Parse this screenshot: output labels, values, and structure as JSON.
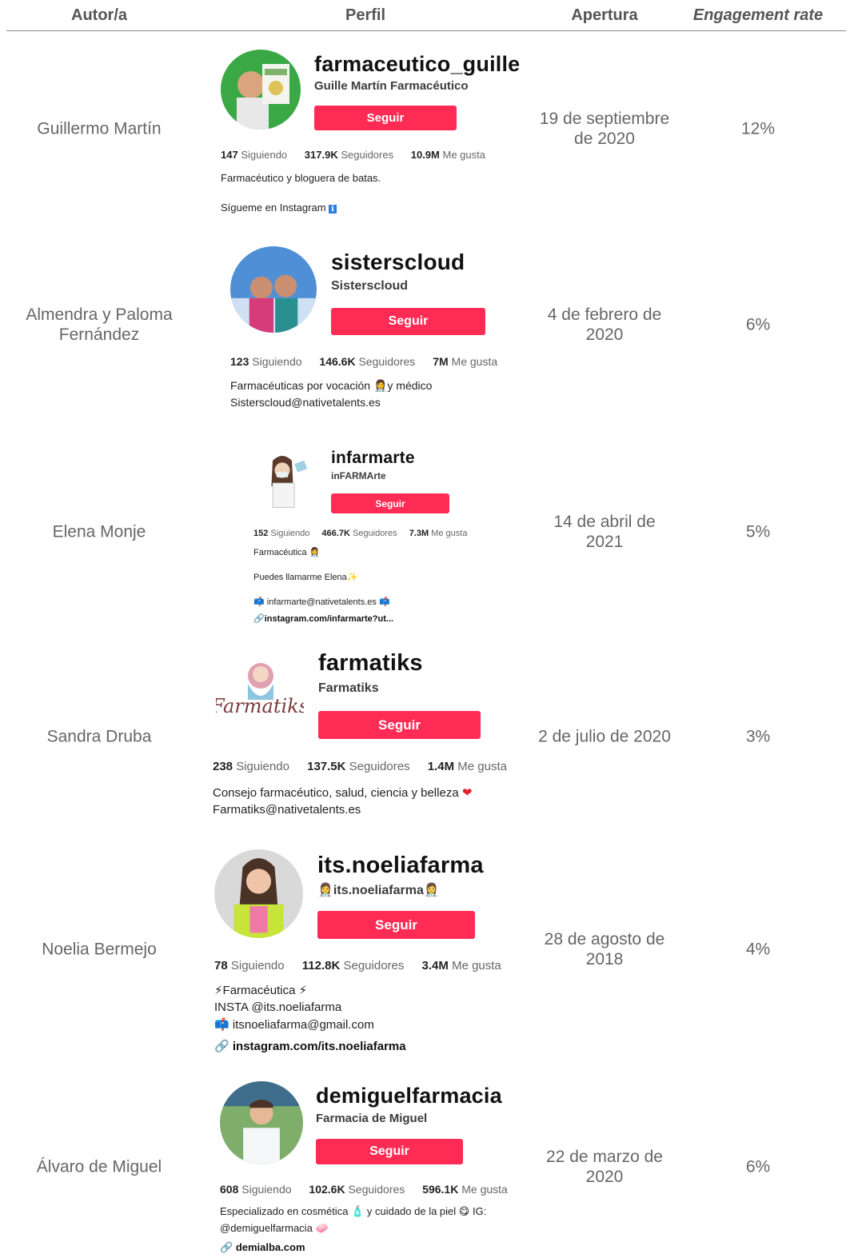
{
  "headers": {
    "author": "Autor/a",
    "profile": "Perfil",
    "opening": "Apertura",
    "engagement": "Engagement rate"
  },
  "rows": [
    {
      "author": "Guillermo Martín",
      "username": "farmaceutico_guille",
      "display_name": "Guille Martín Farmacéutico",
      "follow": "Seguir",
      "following": "147",
      "following_label": "Siguiendo",
      "followers": "317.9K",
      "followers_label": "Seguidores",
      "likes": "10.9M",
      "likes_label": "Me gusta",
      "bio": [
        "Farmacéutico y bloguera de batas.",
        "Sígueme en Instagram"
      ],
      "opening": "19 de septiembre de 2020",
      "engagement": "12%"
    },
    {
      "author": "Almendra y Paloma Fernández",
      "username": "sisterscloud",
      "display_name": "Sisterscloud",
      "follow": "Seguir",
      "following": "123",
      "following_label": "Siguiendo",
      "followers": "146.6K",
      "followers_label": "Seguidores",
      "likes": "7M",
      "likes_label": "Me gusta",
      "bio": [
        "Farmacéuticas por vocación",
        "y médico",
        "Sisterscloud@nativetalents.es"
      ],
      "opening": "4 de febrero de 2020",
      "engagement": "6%"
    },
    {
      "author": "Elena Monje",
      "username": "infarmarte",
      "display_name": "inFARMArte",
      "follow": "Seguir",
      "following": "152",
      "following_label": "Siguiendo",
      "followers": "466.7K",
      "followers_label": "Seguidores",
      "likes": "7.3M",
      "likes_label": "Me gusta",
      "bio": [
        "Farmacéutica",
        "Puedes llamarme Elena",
        "infarmarte@nativetalents.es",
        "instagram.com/infarmarte?ut..."
      ],
      "opening": "14 de abril de 2021",
      "engagement": "5%"
    },
    {
      "author": "Sandra Druba",
      "username": "farmatiks",
      "display_name": "Farmatiks",
      "follow": "Seguir",
      "following": "238",
      "following_label": "Siguiendo",
      "followers": "137.5K",
      "followers_label": "Seguidores",
      "likes": "1.4M",
      "likes_label": "Me gusta",
      "bio": [
        "Consejo farmacéutico, salud, ciencia y belleza",
        "Farmatiks@nativetalents.es"
      ],
      "logo_text": "Farmatiks",
      "opening": "2 de julio de 2020",
      "engagement": "3%"
    },
    {
      "author": "Noelia Bermejo",
      "username": "its.noeliafarma",
      "display_name": "its.noeliafarma",
      "follow": "Seguir",
      "following": "78",
      "following_label": "Siguiendo",
      "followers": "112.8K",
      "followers_label": "Seguidores",
      "likes": "3.4M",
      "likes_label": "Me gusta",
      "bio": [
        "Farmacéutica",
        "INSTA @its.noeliafarma",
        "itsnoeliafarma@gmail.com",
        "instagram.com/its.noeliafarma"
      ],
      "opening": "28 de agosto de 2018",
      "engagement": "4%"
    },
    {
      "author": "Álvaro de Miguel",
      "username": "demiguelfarmacia",
      "display_name": "Farmacia de Miguel",
      "follow": "Seguir",
      "following": "608",
      "following_label": "Siguiendo",
      "followers": "102.6K",
      "followers_label": "Seguidores",
      "likes": "596.1K",
      "likes_label": "Me gusta",
      "bio": [
        "Especializado en cosmética",
        "y cuidado de la piel",
        "IG:",
        "@demiguelfarmacia",
        "demialba.com"
      ],
      "opening": "22 de marzo de 2020",
      "engagement": "6%"
    }
  ]
}
